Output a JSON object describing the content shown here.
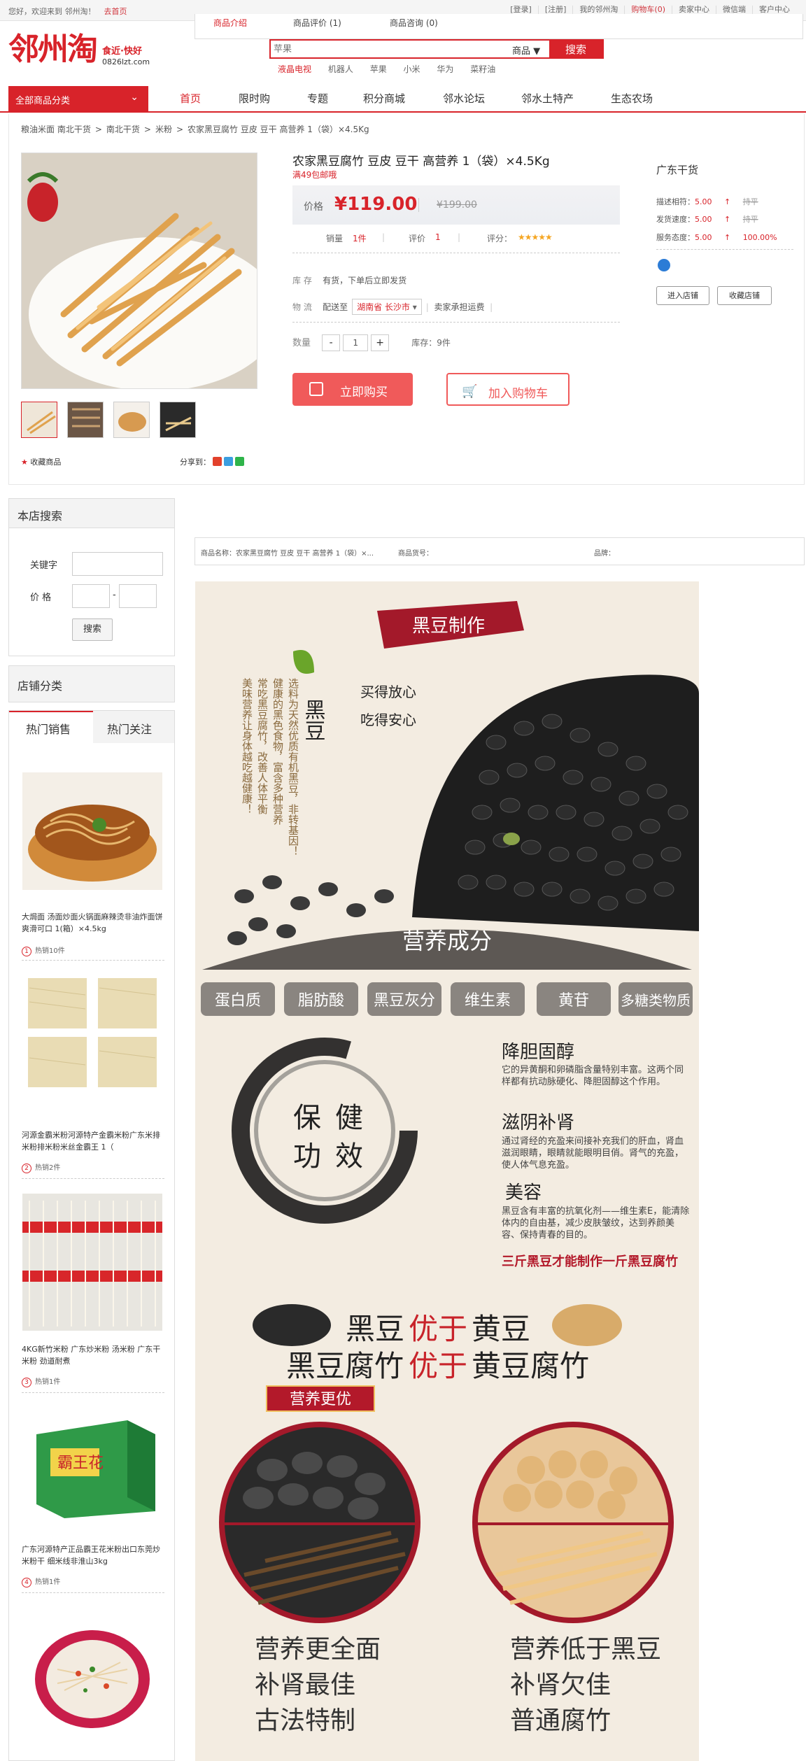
{
  "topbar": {
    "welcome": "您好，欢迎来到 邻州淘！",
    "go_shop": "去首页",
    "links": [
      "[登录]",
      "[注册]",
      "我的邻州淘",
      "购物车(0)",
      "卖家中心",
      "微信端",
      "客户中心"
    ]
  },
  "tabstrip": {
    "items": [
      "商品介绍",
      "商品评价 (1)",
      "商品咨询 (0)"
    ]
  },
  "logo": {
    "main": "邻州淘",
    "slogan": "食近·快好",
    "url": "0826lzt.com"
  },
  "search": {
    "placeholder": "苹果",
    "category": "商品",
    "button": "搜索"
  },
  "hotwords": [
    "液晶电视",
    "机器人",
    "苹果",
    "小米",
    "华为",
    "菜籽油"
  ],
  "category_button": "全部商品分类",
  "nav": [
    "首页",
    "限时购",
    "专题",
    "积分商城",
    "邻水论坛",
    "邻水土特产",
    "生态农场"
  ],
  "breadcrumb": [
    "粮油米面 南北干货",
    ">",
    "南北干货",
    ">",
    "米粉",
    ">",
    "农家黑豆腐竹 豆皮 豆干 高营养 1（袋）×4.5Kg"
  ],
  "product": {
    "title": "农家黑豆腐竹 豆皮 豆干 高营养 1（袋）×4.5Kg",
    "promo": "满49包邮哦",
    "price_label": "价格",
    "price": "¥119.00",
    "old_price": "¥199.00",
    "sales_label": "销量",
    "sales": "1件",
    "reviews_label": "评价",
    "reviews": "1",
    "score_label": "评分：",
    "stars": "★★★★★",
    "stock_label": "库 存",
    "stock_text": "有货，下单后立即发货",
    "logistics_label": "物 流",
    "ship_to": "配送至",
    "region": "湖南省 长沙市",
    "freight": "卖家承担运费",
    "qty_label": "数量",
    "qty": "1",
    "inventory": "库存：9件",
    "buy_now": "立即购买",
    "add_cart": "加入购物车",
    "favorite": "收藏商品",
    "share": "分享到："
  },
  "shop": {
    "name": "广东干货",
    "rows": [
      {
        "label": "描述相符：",
        "score": "5.00",
        "arrow": "↑",
        "trend": "持平"
      },
      {
        "label": "发货速度：",
        "score": "5.00",
        "arrow": "↑",
        "trend": "持平"
      },
      {
        "label": "服务态度：",
        "score": "5.00",
        "arrow": "↑",
        "trend": "100.00%"
      }
    ],
    "enter": "进入店铺",
    "collect": "收藏店铺"
  },
  "store_search": {
    "title": "本店搜索",
    "keyword_label": "关键字",
    "price_label": "价 格",
    "dash": "-",
    "button": "搜索"
  },
  "store_category": "店铺分类",
  "hot": {
    "tabs": [
      "热门销售",
      "热门关注"
    ],
    "items": [
      {
        "title": "大焗面 汤面炒面火锅面麻辣烫非油炸面饼爽滑可口 1(箱）×4.5kg",
        "rank": "1",
        "sold": "热销10件"
      },
      {
        "title": "河源金霸米粉河源特产金霸米粉广东米排米粉排米粉米丝金霸王 1（",
        "rank": "2",
        "sold": "热销2件"
      },
      {
        "title": "4KG新竹米粉 广东炒米粉 汤米粉 广东干米粉 劲道耐煮",
        "rank": "3",
        "sold": "热销1件"
      },
      {
        "title": "广东河源特产正品霸王花米粉出口东莞炒米粉干 细米线非淮山3kg",
        "rank": "4",
        "sold": "热销1件"
      }
    ]
  },
  "detail_bar": {
    "name": "商品名称：农家黑豆腐竹 豆皮 豆干 高营养 1（袋）×...",
    "code": "商品货号：",
    "brand": "品牌："
  },
  "poster": {
    "banner": "黑豆制作",
    "black_bean": "黑豆",
    "line1": "买得放心",
    "line2": "吃得安心",
    "vert": [
      "选料为天然优质有机黑豆，非转基因！",
      "健康的黑色食物，富含多种营养",
      "常吃黑豆腐竹，改善人体平衡",
      "美味营养让身体越吃越健康！"
    ],
    "nutrition_title": "营养成分",
    "pills": [
      "蛋白质",
      "脂肪酸",
      "黑豆灰分",
      "维生素",
      "黄苷",
      "多糖类物质"
    ],
    "circle_text": [
      "保",
      "健",
      "功",
      "效"
    ],
    "benefits": [
      {
        "h": "降胆固醇",
        "t": "它的异黄酮和卵磷脂含量特别丰富。这两个同样都有抗动脉硬化、降胆固醇这个作用。"
      },
      {
        "h": "滋阴补肾",
        "t": "通过肾经的充盈来间接补充我们的肝血，肾血滋润眼睛，眼睛就能眼明目俏。肾气的充盈，使人体气息充盈。"
      },
      {
        "h": "美容",
        "t": "黑豆含有丰富的抗氧化剂——维生素E，能清除体内的自由基，减少皮肤皱纹，达到养颜美容、保持青春的目的。"
      }
    ],
    "claim": "三斤黑豆才能制作一斤黑豆腐竹",
    "compare1": [
      "黑豆",
      "优于",
      "黄豆"
    ],
    "compare2": [
      "黑豆腐竹",
      "优于",
      "黄豆腐竹"
    ],
    "tag": "营养更优",
    "left_list": [
      "营养更全面",
      "补肾最佳",
      "古法特制"
    ],
    "right_list": [
      "营养低于黑豆",
      "补肾欠佳",
      "普通腐竹"
    ]
  },
  "colors": {
    "brand": "#d8232a",
    "accent": "#f05a5a",
    "gold": "#f5a623"
  }
}
